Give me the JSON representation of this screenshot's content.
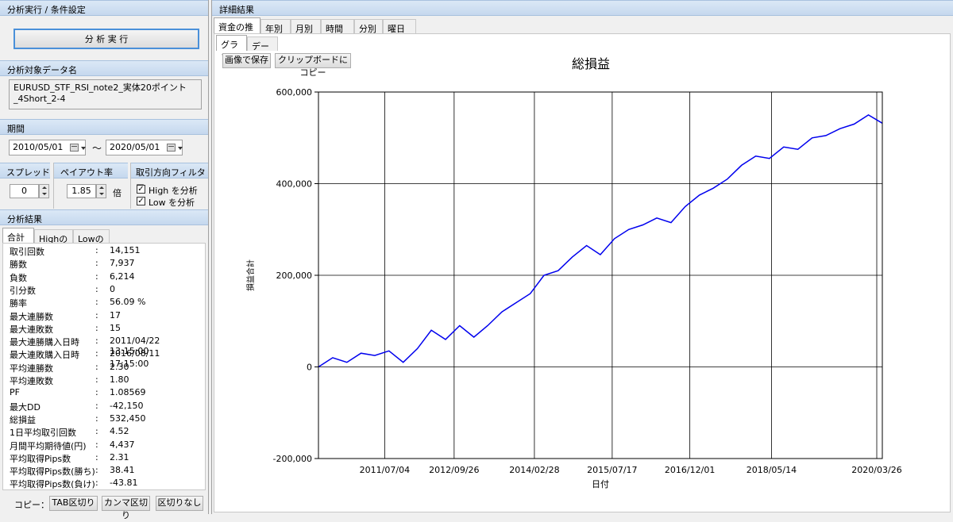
{
  "left": {
    "run_section_title": "分析実行 / 条件設定",
    "run_button": "分 析 実 行",
    "target_section_title": "分析対象データ名",
    "target_name": "EURUSD_STF_RSI_note2_実体20ポイント\n_4Short_2-4",
    "period_section_title": "期間",
    "period_from": "2010/05/01",
    "period_tilde": "～",
    "period_to": "2020/05/01",
    "spread_title": "スプレッド",
    "spread_value": "0",
    "payout_title": "ペイアウト率",
    "payout_value": "1.85",
    "payout_unit": "倍",
    "filter_title": "取引方向フィルター",
    "filter_high": "High を分析",
    "filter_low": "Low を分析",
    "results_section_title": "分析結果",
    "result_tabs": [
      "合計",
      "Highのみ",
      "Lowのみ"
    ],
    "stats": [
      {
        "label": "取引回数",
        "value": "14,151"
      },
      {
        "label": "勝数",
        "value": "7,937"
      },
      {
        "label": "負数",
        "value": "6,214"
      },
      {
        "label": "引分数",
        "value": "0"
      },
      {
        "label": "勝率",
        "value": "56.09 %"
      },
      {
        "label": "最大連勝数",
        "value": "17"
      },
      {
        "label": "最大連敗数",
        "value": "15"
      },
      {
        "label": "最大連勝購入日時",
        "value": "2011/04/22 13:15:00"
      },
      {
        "label": "最大連敗購入日時",
        "value": "2016/08/11 17:15:00"
      },
      {
        "label": "平均連勝数",
        "value": "2.30"
      },
      {
        "label": "平均連敗数",
        "value": "1.80"
      },
      {
        "label": "PF",
        "value": "1.08569"
      },
      {
        "label": "最大DD",
        "value": "-42,150"
      },
      {
        "label": "総損益",
        "value": "532,450"
      },
      {
        "label": "1日平均取引回数",
        "value": "4.52"
      },
      {
        "label": "月間平均期待値(円)",
        "value": "4,437"
      },
      {
        "label": "平均取得Pips数",
        "value": "2.31"
      },
      {
        "label": "平均取得Pips数(勝ち)",
        "value": "38.41"
      },
      {
        "label": "平均取得Pips数(負け)",
        "value": "-43.81"
      }
    ],
    "stats_colon": ":",
    "copy_label": "コピー：",
    "copy_tab": "TAB区切り",
    "copy_comma": "カンマ区切り",
    "copy_none": "区切りなし"
  },
  "right": {
    "section_title": "詳細結果",
    "main_tabs": [
      "資金の推移",
      "年別",
      "月別",
      "時間別",
      "分別",
      "曜日別"
    ],
    "sub_tabs": [
      "グラフ",
      "データ"
    ],
    "save_image_button": "画像で保存",
    "copy_clipboard_button": "クリップボードにコピー"
  },
  "chart_data": {
    "type": "line",
    "title": "総損益",
    "xlabel": "日付",
    "ylabel": "損益合計",
    "ylim": [
      -200000,
      600000
    ],
    "yticks": [
      -200000,
      0,
      200000,
      400000,
      600000
    ],
    "ytick_labels": [
      "-200,000",
      "0",
      "200,000",
      "400,000",
      "600,000"
    ],
    "xlim": [
      "2010/05/01",
      "2020/05/01"
    ],
    "xtick_labels": [
      "2011/07/04",
      "2012/09/26",
      "2014/02/28",
      "2015/07/17",
      "2016/12/01",
      "2018/05/14",
      "2020/03/26"
    ],
    "xticks": [
      "2011/07/04",
      "2012/09/26",
      "2014/02/28",
      "2015/07/17",
      "2016/12/01",
      "2018/05/14",
      "2020/03/26"
    ],
    "grid": true,
    "line_color": "#0000ee",
    "series": [
      {
        "x": [
          "2010/05/01",
          "2010/08/01",
          "2010/11/01",
          "2011/02/01",
          "2011/05/01",
          "2011/08/01",
          "2011/11/01",
          "2012/02/01",
          "2012/05/01",
          "2012/08/01",
          "2012/11/01",
          "2013/02/01",
          "2013/05/01",
          "2013/08/01",
          "2013/11/01",
          "2014/02/01",
          "2014/05/01",
          "2014/08/01",
          "2014/11/01",
          "2015/02/01",
          "2015/05/01",
          "2015/08/01",
          "2015/11/01",
          "2016/02/01",
          "2016/05/01",
          "2016/08/01",
          "2016/11/01",
          "2017/02/01",
          "2017/05/01",
          "2017/08/01",
          "2017/11/01",
          "2018/02/01",
          "2018/05/01",
          "2018/08/01",
          "2018/11/01",
          "2019/02/01",
          "2019/05/01",
          "2019/08/01",
          "2019/11/01",
          "2020/02/01",
          "2020/05/01"
        ],
        "values": [
          0,
          20000,
          10000,
          30000,
          25000,
          35000,
          10000,
          40000,
          80000,
          60000,
          90000,
          65000,
          90000,
          120000,
          140000,
          160000,
          200000,
          210000,
          240000,
          265000,
          245000,
          280000,
          300000,
          310000,
          325000,
          315000,
          350000,
          375000,
          390000,
          410000,
          440000,
          460000,
          455000,
          480000,
          475000,
          500000,
          505000,
          520000,
          530000,
          550000,
          532000
        ]
      }
    ]
  }
}
